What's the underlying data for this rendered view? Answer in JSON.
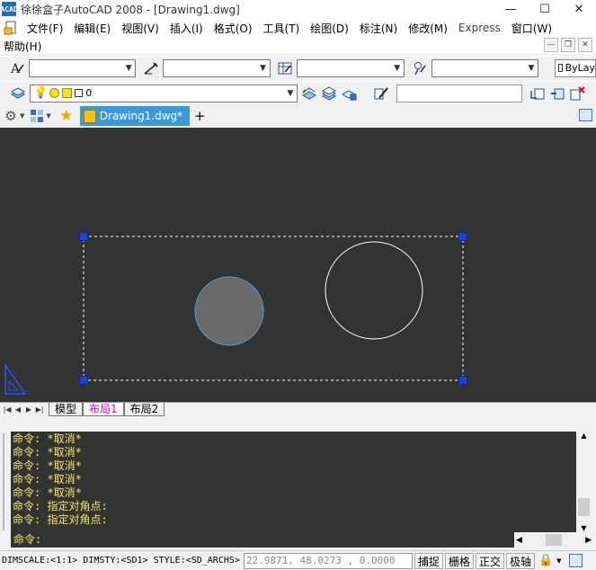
{
  "window": {
    "title": "徐徐盒子AutoCAD 2008 - [Drawing1.dwg]",
    "app_icon_label": "ACAD",
    "minimize": "—",
    "maximize": "☐",
    "close": "✕"
  },
  "menu": {
    "items": [
      "文件(F)",
      "编辑(E)",
      "视图(V)",
      "插入(I)",
      "格式(O)",
      "工具(T)",
      "绘图(D)",
      "标注(N)",
      "修改(M)",
      "Express",
      "窗口(W)"
    ],
    "help": "帮助(H)"
  },
  "mdi": {
    "minimize": "—",
    "restore": "❐",
    "close": "✕"
  },
  "toolbar_row1": {
    "combo1": "",
    "combo2": "",
    "combo3": "",
    "combo4": "",
    "bylayer": "ByLay"
  },
  "toolbar_row2": {
    "layer_name": "0",
    "right_input": ""
  },
  "tabs": {
    "document": "Drawing1.dwg*",
    "new_tab": "+"
  },
  "layout_tabs": [
    "模型",
    "布局1",
    "布局2"
  ],
  "command_history": [
    "命令: *取消*",
    "命令: *取消*",
    "命令: *取消*",
    "命令: *取消*",
    "命令: *取消*",
    "命令: 指定对角点:",
    "命令: 指定对角点:"
  ],
  "command_prompt": "命令:",
  "status": {
    "text": "DIMSCALE:<1:1> DIMSTY:<SD1> STYLE:<SD_ARCHS>",
    "coordinates": "22.9871,  48.0273 , 0.0000",
    "buttons": [
      "捕捉",
      "栅格",
      "正交",
      "极轴"
    ]
  },
  "colors": {
    "canvas_bg": "#333333",
    "command_text": "#f5e664",
    "grip": "#1446e6",
    "active_layout_tab": "#d600d6",
    "doc_tab": "#3a9ad9"
  }
}
